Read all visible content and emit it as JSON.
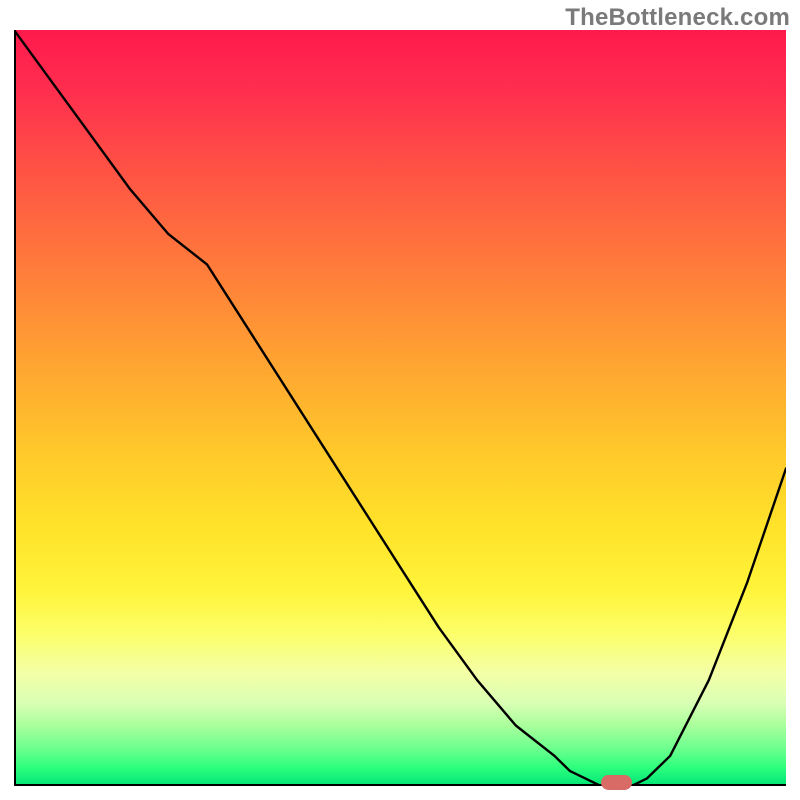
{
  "watermark": "TheBottleneck.com",
  "colors": {
    "curve": "#000000",
    "marker": "#d86b66",
    "gradient_top": "#ff1a4d",
    "gradient_bottom": "#00e676"
  },
  "chart_data": {
    "type": "line",
    "title": "",
    "xlabel": "",
    "ylabel": "",
    "xlim": [
      0,
      100
    ],
    "ylim": [
      0,
      100
    ],
    "x": [
      0,
      5,
      10,
      15,
      20,
      25,
      30,
      35,
      40,
      45,
      50,
      55,
      60,
      65,
      70,
      72,
      74,
      76,
      78,
      80,
      82,
      85,
      90,
      95,
      100
    ],
    "y": [
      100,
      93,
      86,
      79,
      73,
      69,
      61,
      53,
      45,
      37,
      29,
      21,
      14,
      8,
      4,
      2,
      1,
      0,
      0,
      0,
      1,
      4,
      14,
      27,
      42
    ],
    "marker": {
      "x_start": 76,
      "x_end": 80,
      "y": 0.5,
      "height": 2
    },
    "note": "x,y are percentages of plot area; y=100 is top (worst bottleneck), y=0 is bottom (no bottleneck)"
  }
}
